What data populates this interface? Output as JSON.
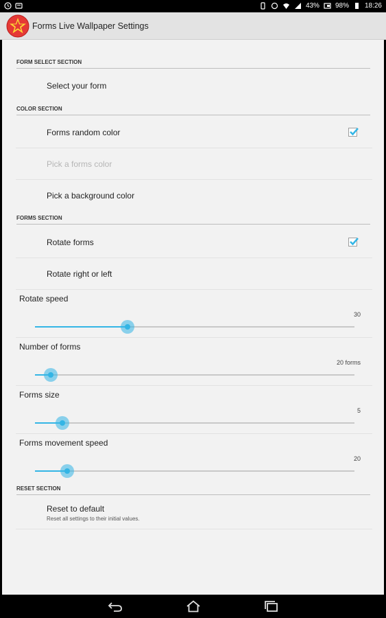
{
  "status_bar": {
    "battery1": "43%",
    "battery2": "98%",
    "time": "18:26"
  },
  "action_bar": {
    "title": "Forms Live Wallpaper Settings",
    "icon": "red-star-icon"
  },
  "sections": {
    "form_select": {
      "header": "FORM SELECT SECTION",
      "select_form": "Select your form"
    },
    "color": {
      "header": "COLOR SECTION",
      "random_color": "Forms random color",
      "random_color_checked": true,
      "pick_forms_color": "Pick a forms color",
      "pick_background_color": "Pick a background color"
    },
    "forms": {
      "header": "FORMS SECTION",
      "rotate_forms": "Rotate forms",
      "rotate_forms_checked": true,
      "rotate_direction": "Rotate right or left"
    },
    "sliders": [
      {
        "label": "Rotate speed",
        "value": "30",
        "fraction": 0.29
      },
      {
        "label": "Number of forms",
        "value": "20 forms",
        "fraction": 0.05
      },
      {
        "label": "Forms size",
        "value": "5",
        "fraction": 0.085
      },
      {
        "label": "Forms movement speed",
        "value": "20",
        "fraction": 0.1
      }
    ],
    "reset": {
      "header": "RESET SECTION",
      "title": "Reset to default",
      "summary": "Reset all settings to their initial values."
    }
  },
  "nav_bar": {
    "back": "back-icon",
    "home": "home-icon",
    "recents": "recents-icon"
  },
  "colors": {
    "accent": "#33b5e5",
    "icon_red": "#e53935",
    "icon_star": "#fdd835"
  }
}
